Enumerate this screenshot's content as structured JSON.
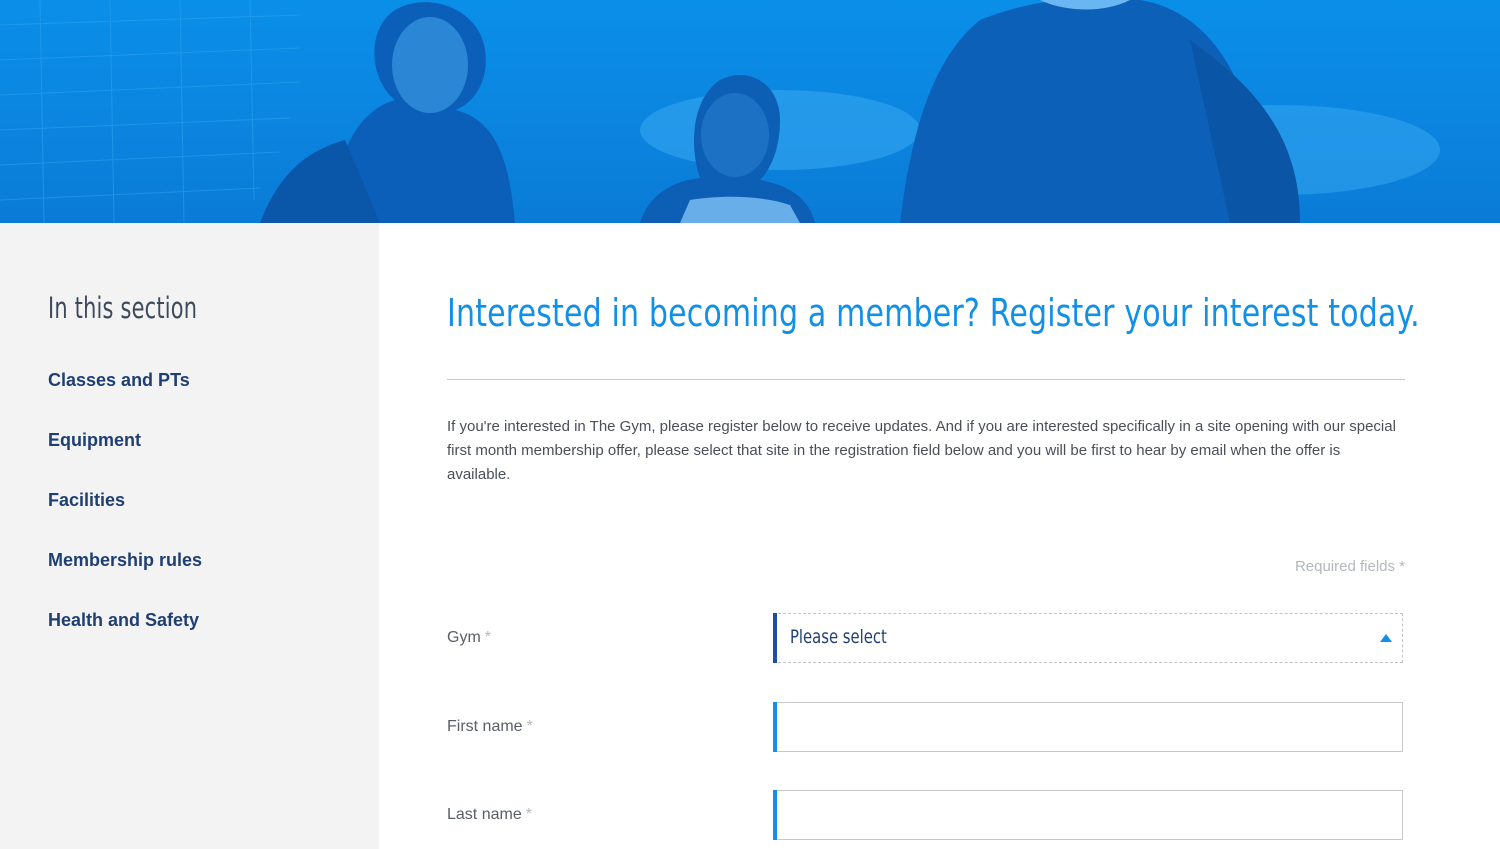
{
  "colors": {
    "accent": "#1190e5",
    "nav_text": "#1f3f73",
    "hero_blue": "#0a8fe8",
    "sidebar_bg": "#f3f3f3"
  },
  "sidebar": {
    "title": "In this section",
    "items": [
      {
        "label": "Classes and PTs"
      },
      {
        "label": "Equipment"
      },
      {
        "label": "Facilities"
      },
      {
        "label": "Membership rules"
      },
      {
        "label": "Health and Safety"
      }
    ]
  },
  "main": {
    "title": "Interested in becoming a member? Register your interest today.",
    "intro": "If you're interested in The Gym, please register below to receive updates. And if you are interested specifically in a site opening with our special first month membership offer, please select that site in the registration field below and you will be first to hear by email when the offer is available.",
    "required_note": "Required fields *"
  },
  "form": {
    "gym": {
      "label": "Gym",
      "required_mark": "*",
      "value": "Please select",
      "icon": "caret-up-icon"
    },
    "first_name": {
      "label": "First name",
      "required_mark": "*",
      "value": ""
    },
    "last_name": {
      "label": "Last name",
      "required_mark": "*",
      "value": ""
    }
  }
}
